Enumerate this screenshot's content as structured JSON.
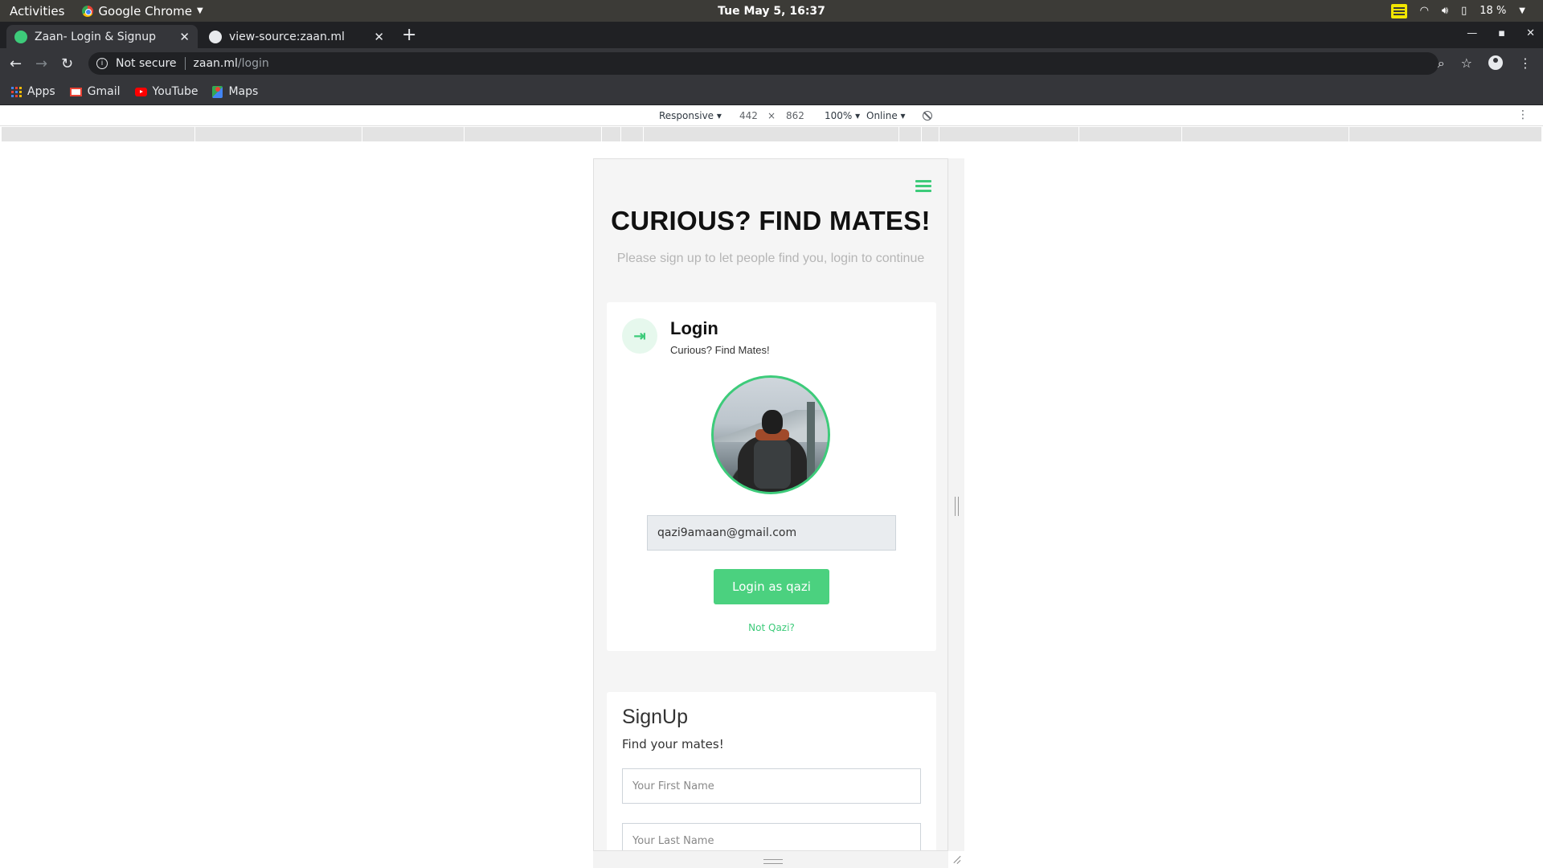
{
  "system_bar": {
    "activities": "Activities",
    "app_name": "Google Chrome",
    "clock": "Tue May  5, 16:37",
    "battery": "18 %"
  },
  "browser": {
    "tabs": [
      {
        "title": "Zaan- Login & Signup",
        "active": true
      },
      {
        "title": "view-source:zaan.ml",
        "active": false
      }
    ],
    "address": {
      "security": "Not secure",
      "domain": "zaan.ml",
      "path": "/login"
    },
    "bookmarks": [
      {
        "label": "Apps",
        "icon": "apps-grid-icon"
      },
      {
        "label": "Gmail",
        "icon": "gmail-icon"
      },
      {
        "label": "YouTube",
        "icon": "youtube-icon"
      },
      {
        "label": "Maps",
        "icon": "maps-icon"
      }
    ]
  },
  "devtools": {
    "device": "Responsive ▾",
    "width": "442",
    "times": "×",
    "height": "862",
    "zoom": "100% ▾",
    "network": "Online ▾"
  },
  "page": {
    "hero_title": "CURIOUS? FIND MATES!",
    "hero_subtitle": "Please sign up to let people find you, login to continue",
    "login": {
      "title": "Login",
      "subtitle": "Curious? Find Mates!",
      "email": "qazi9amaan@gmail.com",
      "button": "Login as qazi",
      "not_user_link": "Not Qazi?"
    },
    "signup": {
      "title": "SignUp",
      "subtitle": "Find your mates!",
      "first_name_placeholder": "Your First Name",
      "last_name_placeholder": "Your Last Name"
    }
  },
  "colors": {
    "accent": "#3dcb7a",
    "button": "#4bd17f"
  }
}
